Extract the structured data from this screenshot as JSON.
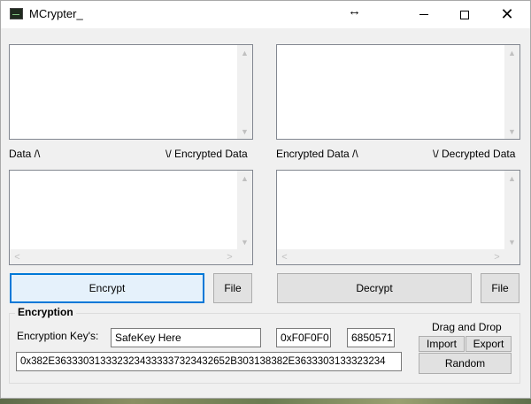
{
  "window": {
    "title": "MCrypter_",
    "move_glyph": "↔",
    "close_glyph": "✕"
  },
  "labels": {
    "data": "Data /\\",
    "encrypted_data_down": "\\/ Encrypted Data",
    "encrypted_data_up": "Encrypted Data /\\",
    "decrypted_data_down": "\\/ Decrypted Data"
  },
  "buttons": {
    "encrypt": "Encrypt",
    "file_left": "File",
    "decrypt": "Decrypt",
    "file_right": "File",
    "import": "Import",
    "export": "Export",
    "random": "Random"
  },
  "encryption": {
    "group_title": "Encryption",
    "key_label": "Encryption Key's:",
    "key_value": "SafeKey Here",
    "hex_key": "0xF0F0F0",
    "numeric_key": "6850571",
    "long_key": "0x382E3633303133323234333337323432652B303138382E3633303133323234",
    "drag_drop_label": "Drag and Drop"
  },
  "scroll_glyphs": {
    "up": "▲",
    "down": "▼",
    "left": "<",
    "right": ">"
  },
  "icons": [
    "app-icon",
    "move-icon",
    "minimize-icon",
    "maximize-icon",
    "close-icon",
    "scroll-up-icon",
    "scroll-down-icon",
    "scroll-left-icon",
    "scroll-right-icon"
  ]
}
